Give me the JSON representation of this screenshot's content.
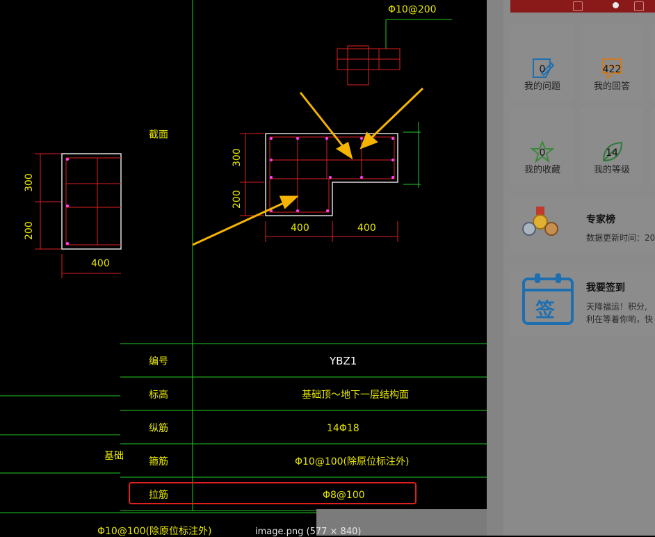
{
  "cad": {
    "top_spec": "Φ10@200",
    "row_labels": [
      "截面",
      "编号",
      "标高",
      "纵筋",
      "箍筋",
      "拉筋"
    ],
    "values": {
      "id": "YBZ1",
      "elevation": "基础顶～地下一层结构面",
      "longitudinal": "14Φ18",
      "stirrup": "Φ10@100(除原位标注外)",
      "tie": "Φ8@100"
    },
    "dims": {
      "d300": "300",
      "d200": "200",
      "d400a": "400",
      "d400b": "400"
    },
    "left_dims": {
      "d300": "300",
      "d200": "200",
      "d400": "400"
    },
    "left_partial": "基础",
    "bottom_text": "Φ10@100(除原位标注外)"
  },
  "image_caption": "image.png (577 × 840)",
  "stats": [
    {
      "value": "0",
      "label": "我的问题",
      "icon": "edit-icon",
      "color": "#1e6fb0"
    },
    {
      "value": "422",
      "label": "我的回答",
      "icon": "chat-icon",
      "color": "#d07a20"
    },
    {
      "value": "0",
      "label": "我的收藏",
      "icon": "star-icon",
      "color": "#3a8a3a"
    },
    {
      "value": "14",
      "label": "我的等级",
      "icon": "leaf-icon",
      "color": "#2f7a3a"
    }
  ],
  "experts": {
    "title": "专家榜",
    "subtitle": "数据更新时间：20"
  },
  "checkin": {
    "title": "我要签到",
    "line1": "天降福运！积分,",
    "line2": "利在等着你哟，快",
    "badge": "签"
  },
  "colors": {
    "highlight": "#e02020",
    "arrow": "#f5b400",
    "grid": "#22cc22"
  }
}
